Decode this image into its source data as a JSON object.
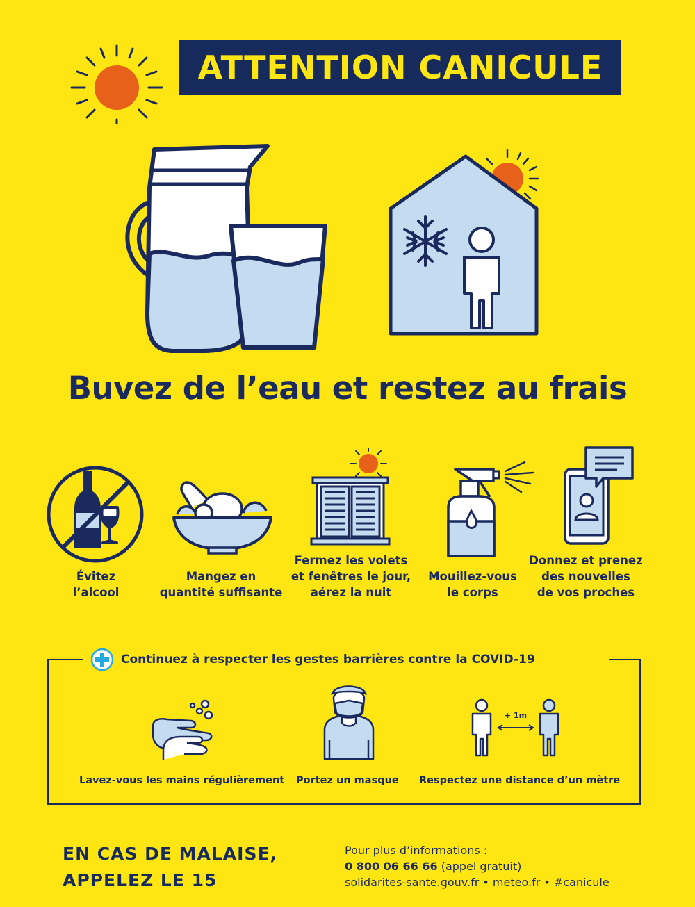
{
  "poster": {
    "title": "ATTENTION CANICULE",
    "headline": "Buvez de l’eau et restez au frais"
  },
  "tips": [
    {
      "icon": "no-alcohol-icon",
      "label": "Évitez\nl’alcool"
    },
    {
      "icon": "salad-bowl-icon",
      "label": "Mangez en\nquantité suffisante"
    },
    {
      "icon": "shutters-icon",
      "label": "Fermez les volets\net fenêtres le jour,\naérez la nuit"
    },
    {
      "icon": "spray-bottle-icon",
      "label": "Mouillez-vous\nle corps"
    },
    {
      "icon": "phone-message-icon",
      "label": "Donnez et prenez\ndes nouvelles\nde vos proches"
    }
  ],
  "covid": {
    "title": "Continuez à respecter les gestes barrières contre la COVID-19",
    "items": [
      {
        "icon": "hand-washing-icon",
        "label": "Lavez-vous les mains régulièrement"
      },
      {
        "icon": "mask-person-icon",
        "label": "Portez un masque"
      },
      {
        "icon": "distance-icon",
        "label": "Respectez une distance d’un mètre"
      }
    ],
    "distance_label": "+ 1m"
  },
  "footer": {
    "emergency": "EN CAS DE MALAISE,\nAPPELEZ LE 15",
    "info_label": "Pour plus d’informations :",
    "phone": "0 800 06 66 66",
    "phone_note": " (appel gratuit)",
    "links": "solidarites-sante.gouv.fr • meteo.fr • #canicule"
  },
  "colors": {
    "background": "#FFE512",
    "navy": "#1B2A5E",
    "sun": "#E8611A",
    "light_blue": "#C5DCF0",
    "cyan_accent": "#26A9E0"
  }
}
